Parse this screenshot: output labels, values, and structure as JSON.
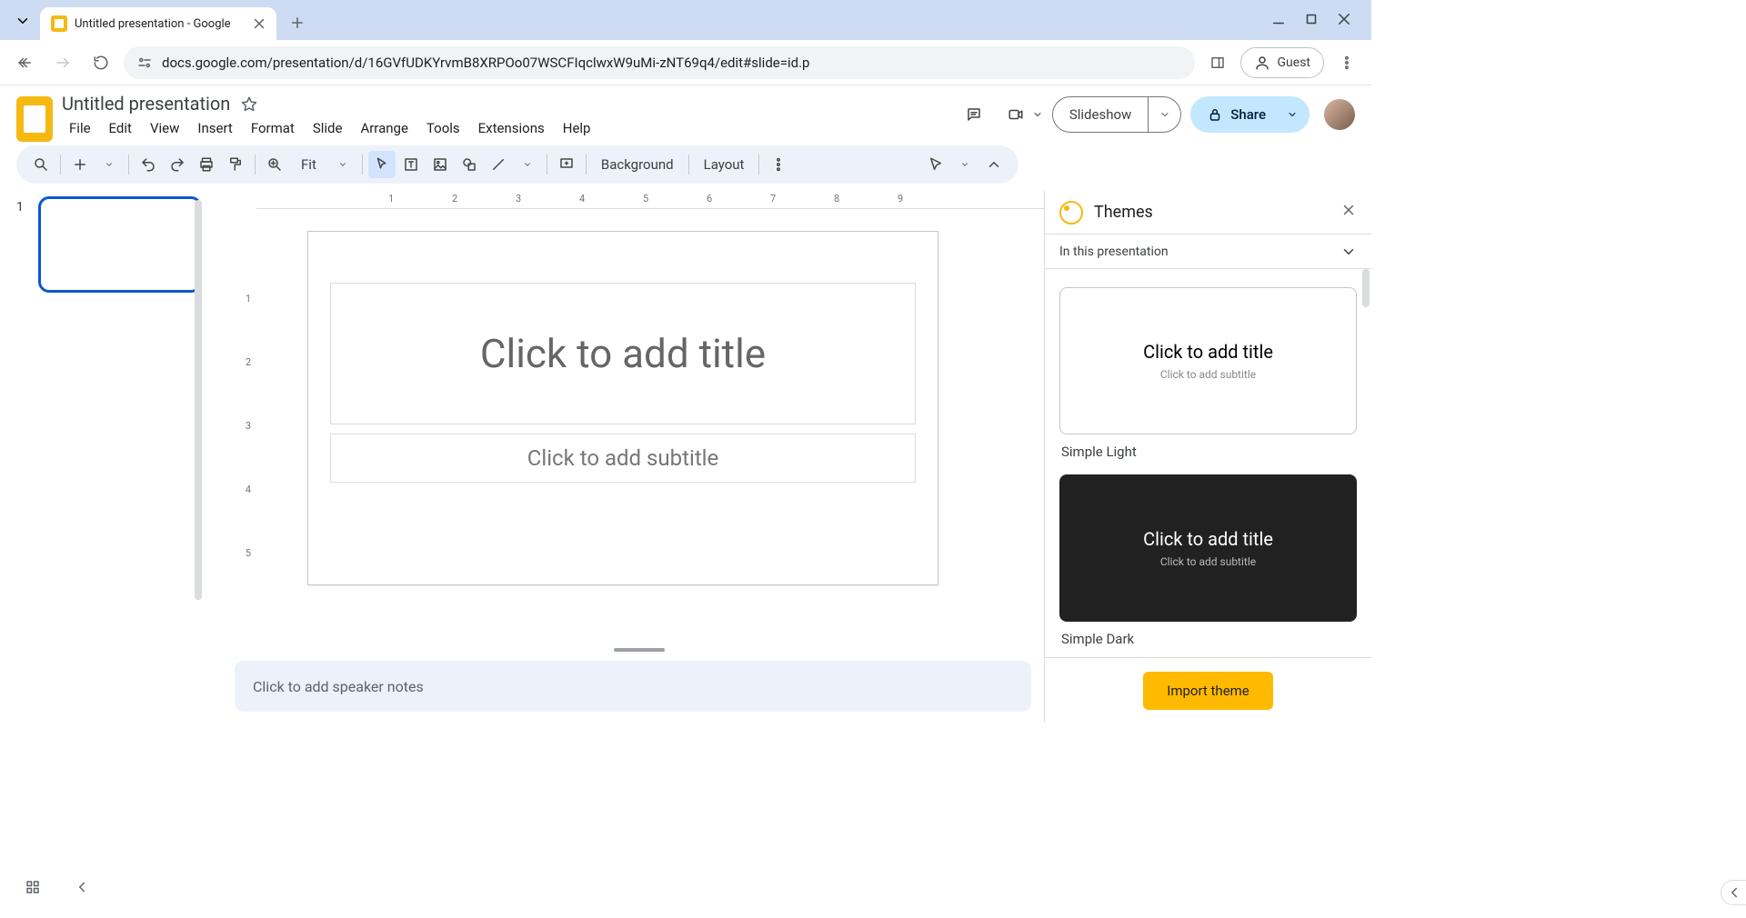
{
  "browser": {
    "tab_title": "Untitled presentation - Google",
    "url": "docs.google.com/presentation/d/16GVfUDKYrvmB8XRPOo07WSCFIqclwxW9uMi-zNT69q4/edit#slide=id.p",
    "guest_label": "Guest"
  },
  "doc": {
    "title": "Untitled presentation",
    "menus": [
      "File",
      "Edit",
      "View",
      "Insert",
      "Format",
      "Slide",
      "Arrange",
      "Tools",
      "Extensions",
      "Help"
    ],
    "slideshow_label": "Slideshow",
    "share_label": "Share"
  },
  "toolbar": {
    "zoom_label": "Fit",
    "background_label": "Background",
    "layout_label": "Layout"
  },
  "filmstrip": {
    "slide_number": "1"
  },
  "ruler": {
    "h": [
      "1",
      "2",
      "3",
      "4",
      "5",
      "6",
      "7",
      "8",
      "9"
    ],
    "v": [
      "1",
      "2",
      "3",
      "4",
      "5"
    ]
  },
  "slide": {
    "title_placeholder": "Click to add title",
    "subtitle_placeholder": "Click to add subtitle"
  },
  "notes": {
    "placeholder": "Click to add speaker notes"
  },
  "themes": {
    "header": "Themes",
    "section": "In this presentation",
    "cards": [
      {
        "title": "Click to add title",
        "subtitle": "Click to add subtitle",
        "label": "Simple Light"
      },
      {
        "title": "Click to add title",
        "subtitle": "Click to add subtitle",
        "label": "Simple Dark"
      }
    ],
    "import_label": "Import theme"
  }
}
